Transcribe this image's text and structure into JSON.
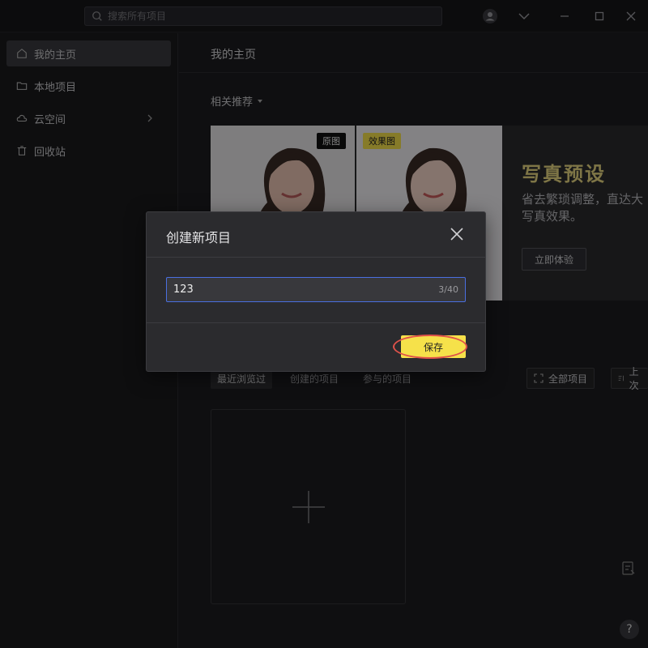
{
  "search": {
    "placeholder": "搜索所有项目"
  },
  "sidebar": {
    "items": [
      {
        "label": "我的主页",
        "icon": "home-icon",
        "active": true
      },
      {
        "label": "本地项目",
        "icon": "folder-icon"
      },
      {
        "label": "云空间",
        "icon": "cloud-icon"
      },
      {
        "label": "回收站",
        "icon": "trash-icon"
      }
    ]
  },
  "main": {
    "title": "我的主页",
    "recommend_label": "相关推荐",
    "banner": {
      "tag_original": "原图",
      "tag_effect": "效果图",
      "title": "写真预设",
      "desc_line1": "省去繁琐调整，直达大",
      "desc_line2": "写真效果。",
      "button": "立即体验"
    },
    "tabs": [
      "最近浏览过",
      "创建的项目",
      "参与的项目"
    ],
    "filter_all": "全部项目",
    "sort_label": "上次"
  },
  "modal": {
    "title": "创建新项目",
    "input_value": "123",
    "counter": "3/40",
    "save_label": "保存"
  },
  "help": {
    "label": "?"
  },
  "colors": {
    "accent_yellow": "#f6e14a",
    "input_focus": "#4a6fe0",
    "highlight": "#e0524a"
  }
}
